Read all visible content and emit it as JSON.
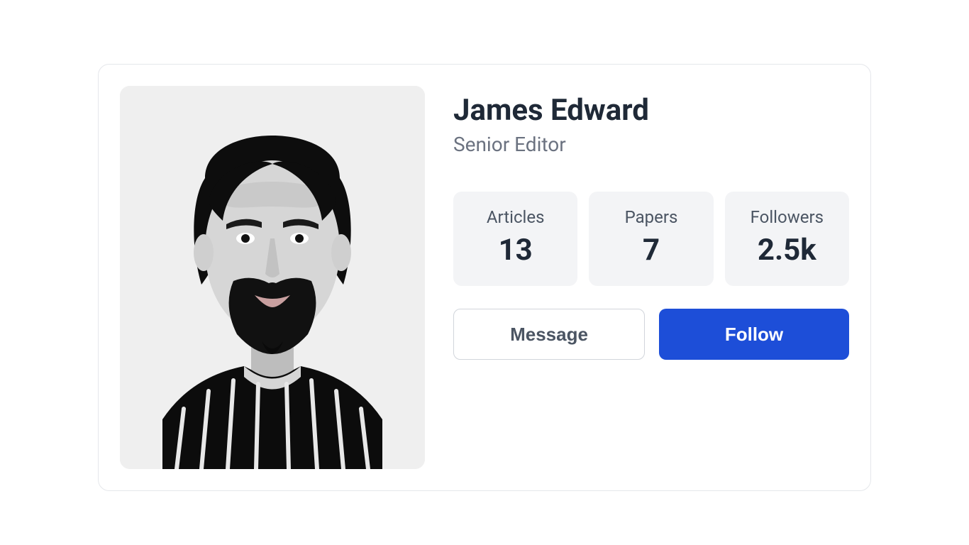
{
  "profile": {
    "name": "James Edward",
    "role": "Senior Editor"
  },
  "stats": [
    {
      "label": "Articles",
      "value": "13"
    },
    {
      "label": "Papers",
      "value": "7"
    },
    {
      "label": "Followers",
      "value": "2.5k"
    }
  ],
  "actions": {
    "message": "Message",
    "follow": "Follow"
  },
  "colors": {
    "primary": "#1d4ed8",
    "text_primary": "#1f2937",
    "text_secondary": "#6b7280",
    "stat_bg": "#f3f4f6",
    "border": "#e5e7eb"
  }
}
